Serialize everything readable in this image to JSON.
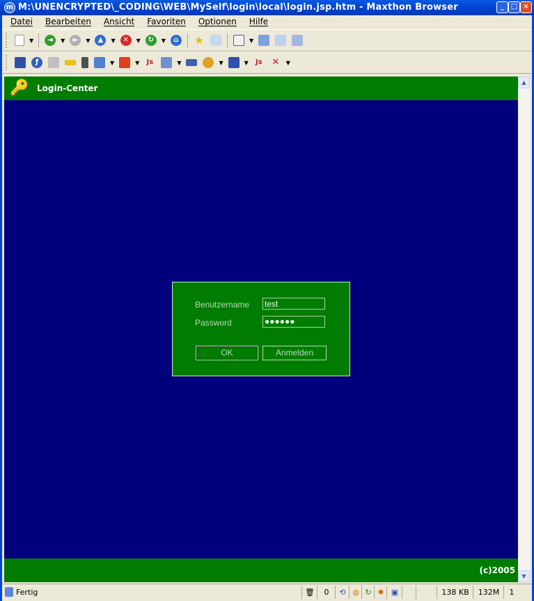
{
  "window": {
    "title": "M:\\UNENCRYPTED\\_CODING\\WEB\\MySelf\\login\\local\\login.jsp.htm - Maxthon Browser",
    "app_icon_letter": "m",
    "minimize": "_",
    "maximize": "□",
    "close": "×"
  },
  "menu": [
    "Datei",
    "Bearbeiten",
    "Ansicht",
    "Favoriten",
    "Optionen",
    "Hilfe"
  ],
  "page": {
    "header_title": "Login-Center",
    "footer_copyright": "(c)2005",
    "login": {
      "username_label": "Benutzername",
      "username_value": "test",
      "password_label": "Password",
      "password_value": "●●●●●●",
      "ok_button": "OK",
      "register_button": "Anmelden"
    }
  },
  "status": {
    "text": "Fertig",
    "counter": "0",
    "memory_kb": "138 KB",
    "memory_m": "132M",
    "tabs": "1"
  },
  "colors": {
    "page_bg": "#00007d",
    "bar_green": "#007d00",
    "title_blue": "#0046d6"
  }
}
